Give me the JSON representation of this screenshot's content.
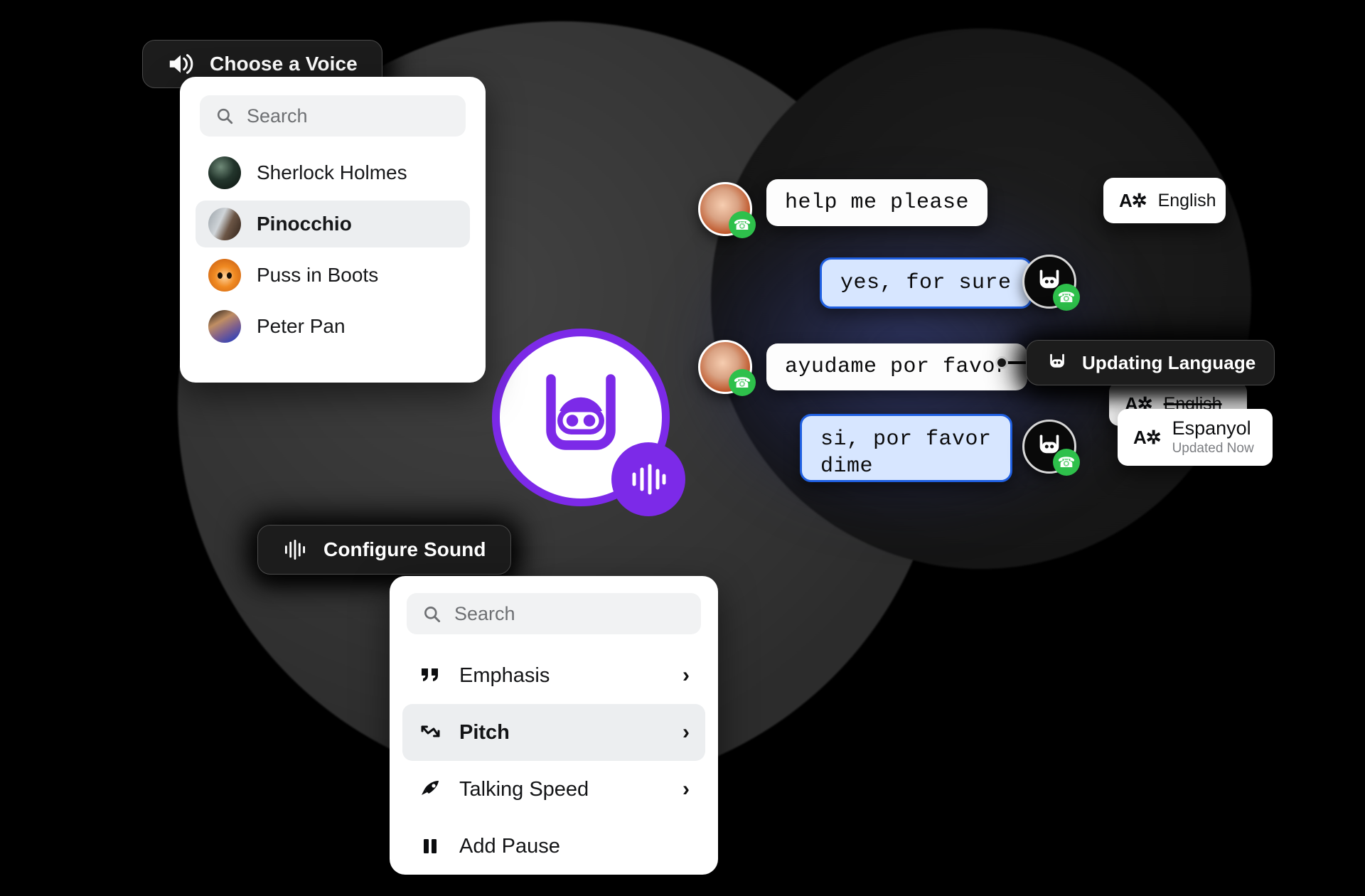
{
  "voice_picker": {
    "button_label": "Choose a Voice",
    "button_icon": "speaker-icon",
    "search_placeholder": "Search",
    "search_icon": "search-icon",
    "items": [
      {
        "label": "Sherlock Holmes",
        "avatar": "sherlock-avatar",
        "selected": false
      },
      {
        "label": "Pinocchio",
        "avatar": "pinocchio-avatar",
        "selected": true
      },
      {
        "label": "Puss in Boots",
        "avatar": "puss-in-boots-avatar",
        "selected": false
      },
      {
        "label": "Peter Pan",
        "avatar": "peter-pan-avatar",
        "selected": false
      }
    ]
  },
  "sound_config": {
    "button_label": "Configure Sound",
    "button_icon": "soundwave-icon",
    "search_placeholder": "Search",
    "search_icon": "search-icon",
    "items": [
      {
        "label": "Emphasis",
        "icon": "quote-icon",
        "chevron": "›",
        "selected": false
      },
      {
        "label": "Pitch",
        "icon": "pitch-arrow-icon",
        "chevron": "›",
        "selected": true
      },
      {
        "label": "Talking Speed",
        "icon": "rocket-icon",
        "chevron": "›",
        "selected": false
      },
      {
        "label": "Add Pause",
        "icon": "pause-icon",
        "chevron": "",
        "selected": false
      }
    ]
  },
  "conversation": {
    "messages": [
      {
        "text": "help me please",
        "side": "incoming",
        "avatar": "human-avatar",
        "badge": "phone-icon"
      },
      {
        "text": "yes, for sure",
        "side": "outgoing",
        "avatar": "bot-avatar",
        "badge": "phone-icon"
      },
      {
        "text": "ayudame por favor",
        "side": "incoming",
        "avatar": "human-avatar",
        "badge": "phone-icon"
      },
      {
        "text": "si, por favor\ndime",
        "side": "outgoing",
        "avatar": "bot-avatar",
        "badge": "phone-icon"
      }
    ]
  },
  "language": {
    "current_label": "English",
    "current_icon": "translate-icon",
    "updating_label": "Updating Language",
    "updating_icon": "bot-icon",
    "previous_label": "English",
    "previous_icon": "translate-icon",
    "new_label": "Espanyol",
    "new_icon": "translate-icon",
    "new_status": "Updated Now"
  },
  "brand": {
    "logo_icon": "bot-logo-icon",
    "wave_icon": "soundwave-icon",
    "accent_color": "#7c2ae8",
    "bubble_blue": "#d7e6ff",
    "bubble_blue_border": "#1f5fe0",
    "badge_green": "#2ec04b"
  }
}
